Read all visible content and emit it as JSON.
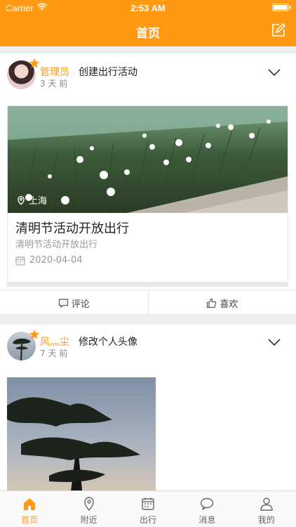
{
  "status": {
    "carrier": "Carrier",
    "time": "2:53 AM"
  },
  "header": {
    "title": "首页"
  },
  "colors": {
    "accent": "#ff9a12"
  },
  "posts": [
    {
      "author": "管理员",
      "ago": "3 天 前",
      "action": "创建出行活动",
      "location": "上海",
      "title": "清明节活动开放出行",
      "desc": "清明节活动开放出行",
      "date": "2020-04-04",
      "comment_label": "评论",
      "like_label": "喜欢"
    },
    {
      "author": "风灬尘",
      "ago": "7 天 前",
      "action": "修改个人头像"
    }
  ],
  "tabs": [
    {
      "label": "首页",
      "icon": "home-icon"
    },
    {
      "label": "附近",
      "icon": "location-pin-icon"
    },
    {
      "label": "出行",
      "icon": "calendar-icon"
    },
    {
      "label": "消息",
      "icon": "chat-bubble-icon"
    },
    {
      "label": "我的",
      "icon": "person-icon"
    }
  ]
}
